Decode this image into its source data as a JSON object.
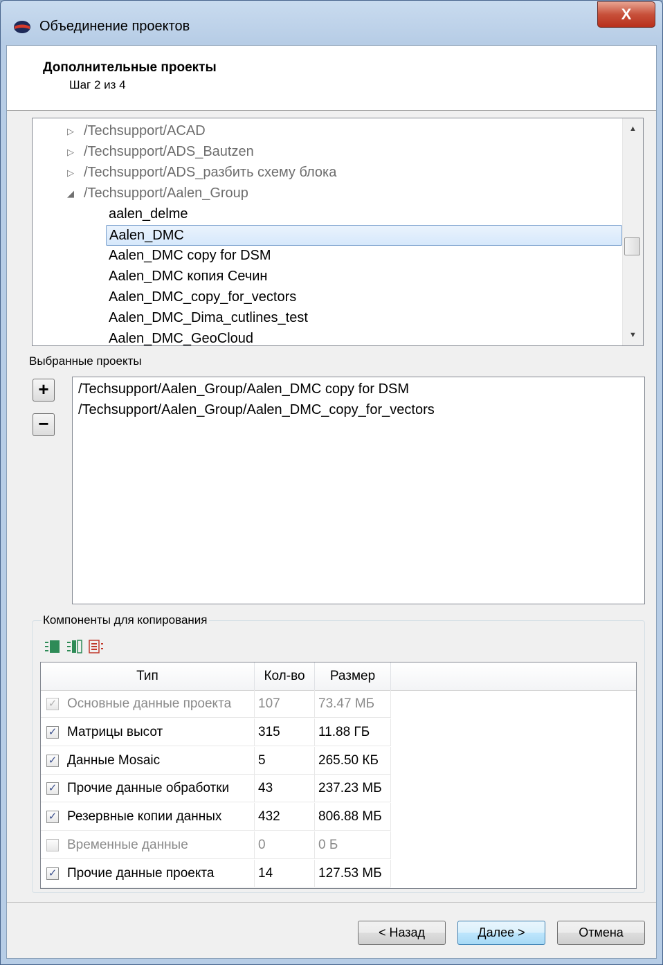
{
  "window": {
    "title": "Объединение проектов",
    "close_glyph": "X",
    "icon": "app-glasses-icon"
  },
  "header": {
    "title": "Дополнительные проекты",
    "step": "Шаг 2 из 4"
  },
  "tree": {
    "rows": [
      {
        "label": "/Techsupport/ACAD",
        "type": "folder",
        "state": "collapsed"
      },
      {
        "label": "/Techsupport/ADS_Bautzen",
        "type": "folder",
        "state": "collapsed"
      },
      {
        "label": "/Techsupport/ADS_разбить схему блока",
        "type": "folder",
        "state": "collapsed"
      },
      {
        "label": "/Techsupport/Aalen_Group",
        "type": "folder",
        "state": "expanded"
      },
      {
        "label": "aalen_delme",
        "type": "project"
      },
      {
        "label": "Aalen_DMC",
        "type": "project",
        "selected": true
      },
      {
        "label": "Aalen_DMC copy for DSM",
        "type": "project"
      },
      {
        "label": "Aalen_DMC копия Сечин",
        "type": "project"
      },
      {
        "label": "Aalen_DMC_copy_for_vectors",
        "type": "project"
      },
      {
        "label": "Aalen_DMC_Dima_cutlines_test",
        "type": "project"
      },
      {
        "label": "Aalen_DMC_GeoCloud",
        "type": "project"
      }
    ],
    "glyphs": {
      "collapsed": "▷",
      "expanded": "◢",
      "scroll_up": "▲",
      "scroll_down": "▼"
    }
  },
  "selected": {
    "label": "Выбранные проекты",
    "add": "+",
    "remove": "−",
    "items": [
      "/Techsupport/Aalen_Group/Aalen_DMC copy for DSM",
      "/Techsupport/Aalen_Group/Aalen_DMC_copy_for_vectors"
    ]
  },
  "components": {
    "title": "Компоненты для копирования",
    "columns": {
      "type": "Тип",
      "count": "Кол-во",
      "size": "Размер"
    },
    "rows": [
      {
        "type": "Основные данные проекта",
        "count": "107",
        "size": "73.47 МБ",
        "checked": true,
        "disabled": true
      },
      {
        "type": "Матрицы высот",
        "count": "315",
        "size": "11.88 ГБ",
        "checked": true,
        "disabled": false
      },
      {
        "type": "Данные Mosaic",
        "count": "5",
        "size": "265.50 КБ",
        "checked": true,
        "disabled": false
      },
      {
        "type": "Прочие данные обработки",
        "count": "43",
        "size": "237.23 МБ",
        "checked": true,
        "disabled": false
      },
      {
        "type": "Резервные копии данных",
        "count": "432",
        "size": "806.88 МБ",
        "checked": true,
        "disabled": false
      },
      {
        "type": "Временные данные",
        "count": "0",
        "size": "0 Б",
        "checked": false,
        "disabled": true
      },
      {
        "type": "Прочие данные проекта",
        "count": "14",
        "size": "127.53 МБ",
        "checked": true,
        "disabled": false
      }
    ],
    "check_glyph": "✓"
  },
  "buttons": {
    "back": "< Назад",
    "next": "Далее >",
    "cancel": "Отмена"
  },
  "colors": {
    "selection": "#d6e8fb",
    "selection_border": "#7da2ce",
    "close_red": "#c7503a",
    "toolbar_green": "#2e8b57",
    "toolbar_red": "#c0392b"
  }
}
